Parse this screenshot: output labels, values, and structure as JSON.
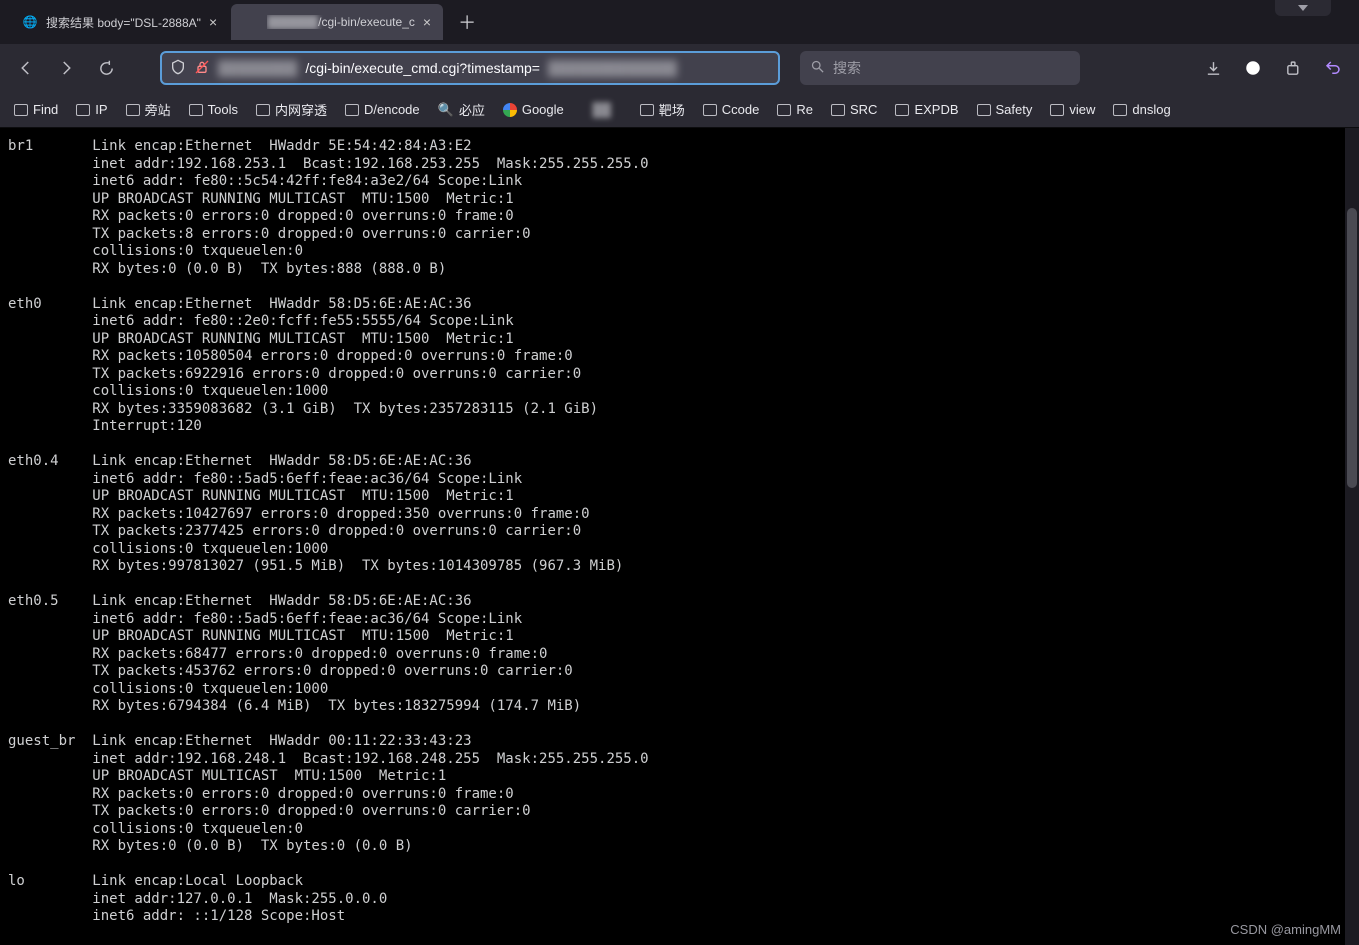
{
  "tabs": [
    {
      "title": "搜索结果 body=\"DSL-2888A\"",
      "active": false
    },
    {
      "title_prefix_blurred": "██████",
      "title_suffix": "/cgi-bin/execute_c",
      "active": true
    }
  ],
  "url": {
    "host_blurred": "████████",
    "path": "/cgi-bin/execute_cmd.cgi?timestamp=",
    "qs_blurred": "█████████████"
  },
  "search_placeholder": "搜索",
  "bookmarks": [
    {
      "kind": "folder",
      "label": "Find"
    },
    {
      "kind": "folder",
      "label": "IP"
    },
    {
      "kind": "folder",
      "label": "旁站"
    },
    {
      "kind": "folder",
      "label": "Tools"
    },
    {
      "kind": "folder",
      "label": "内网穿透"
    },
    {
      "kind": "folder",
      "label": "D/encode"
    },
    {
      "kind": "search",
      "label": "必应"
    },
    {
      "kind": "google",
      "label": "Google"
    },
    {
      "kind": "blurred",
      "label": ""
    },
    {
      "kind": "folder",
      "label": "靶场"
    },
    {
      "kind": "folder",
      "label": "Ccode"
    },
    {
      "kind": "folder",
      "label": "Re"
    },
    {
      "kind": "folder",
      "label": "SRC"
    },
    {
      "kind": "folder",
      "label": "EXPDB"
    },
    {
      "kind": "folder",
      "label": "Safety"
    },
    {
      "kind": "folder",
      "label": "view"
    },
    {
      "kind": "folder",
      "label": "dnslog"
    }
  ],
  "ifconfig": [
    {
      "name": "br1",
      "lines": [
        "Link encap:Ethernet  HWaddr 5E:54:42:84:A3:E2",
        "inet addr:192.168.253.1  Bcast:192.168.253.255  Mask:255.255.255.0",
        "inet6 addr: fe80::5c54:42ff:fe84:a3e2/64 Scope:Link",
        "UP BROADCAST RUNNING MULTICAST  MTU:1500  Metric:1",
        "RX packets:0 errors:0 dropped:0 overruns:0 frame:0",
        "TX packets:8 errors:0 dropped:0 overruns:0 carrier:0",
        "collisions:0 txqueuelen:0",
        "RX bytes:0 (0.0 B)  TX bytes:888 (888.0 B)"
      ]
    },
    {
      "name": "eth0",
      "lines": [
        "Link encap:Ethernet  HWaddr 58:D5:6E:AE:AC:36",
        "inet6 addr: fe80::2e0:fcff:fe55:5555/64 Scope:Link",
        "UP BROADCAST RUNNING MULTICAST  MTU:1500  Metric:1",
        "RX packets:10580504 errors:0 dropped:0 overruns:0 frame:0",
        "TX packets:6922916 errors:0 dropped:0 overruns:0 carrier:0",
        "collisions:0 txqueuelen:1000",
        "RX bytes:3359083682 (3.1 GiB)  TX bytes:2357283115 (2.1 GiB)",
        "Interrupt:120"
      ]
    },
    {
      "name": "eth0.4",
      "lines": [
        "Link encap:Ethernet  HWaddr 58:D5:6E:AE:AC:36",
        "inet6 addr: fe80::5ad5:6eff:feae:ac36/64 Scope:Link",
        "UP BROADCAST RUNNING MULTICAST  MTU:1500  Metric:1",
        "RX packets:10427697 errors:0 dropped:350 overruns:0 frame:0",
        "TX packets:2377425 errors:0 dropped:0 overruns:0 carrier:0",
        "collisions:0 txqueuelen:1000",
        "RX bytes:997813027 (951.5 MiB)  TX bytes:1014309785 (967.3 MiB)"
      ]
    },
    {
      "name": "eth0.5",
      "lines": [
        "Link encap:Ethernet  HWaddr 58:D5:6E:AE:AC:36",
        "inet6 addr: fe80::5ad5:6eff:feae:ac36/64 Scope:Link",
        "UP BROADCAST RUNNING MULTICAST  MTU:1500  Metric:1",
        "RX packets:68477 errors:0 dropped:0 overruns:0 frame:0",
        "TX packets:453762 errors:0 dropped:0 overruns:0 carrier:0",
        "collisions:0 txqueuelen:1000",
        "RX bytes:6794384 (6.4 MiB)  TX bytes:183275994 (174.7 MiB)"
      ]
    },
    {
      "name": "guest_br",
      "lines": [
        "Link encap:Ethernet  HWaddr 00:11:22:33:43:23",
        "inet addr:192.168.248.1  Bcast:192.168.248.255  Mask:255.255.255.0",
        "UP BROADCAST MULTICAST  MTU:1500  Metric:1",
        "RX packets:0 errors:0 dropped:0 overruns:0 frame:0",
        "TX packets:0 errors:0 dropped:0 overruns:0 carrier:0",
        "collisions:0 txqueuelen:0",
        "RX bytes:0 (0.0 B)  TX bytes:0 (0.0 B)"
      ]
    },
    {
      "name": "lo",
      "lines": [
        "Link encap:Local Loopback",
        "inet addr:127.0.0.1  Mask:255.0.0.0",
        "inet6 addr: ::1/128 Scope:Host"
      ]
    }
  ],
  "watermark": "CSDN @amingMM"
}
